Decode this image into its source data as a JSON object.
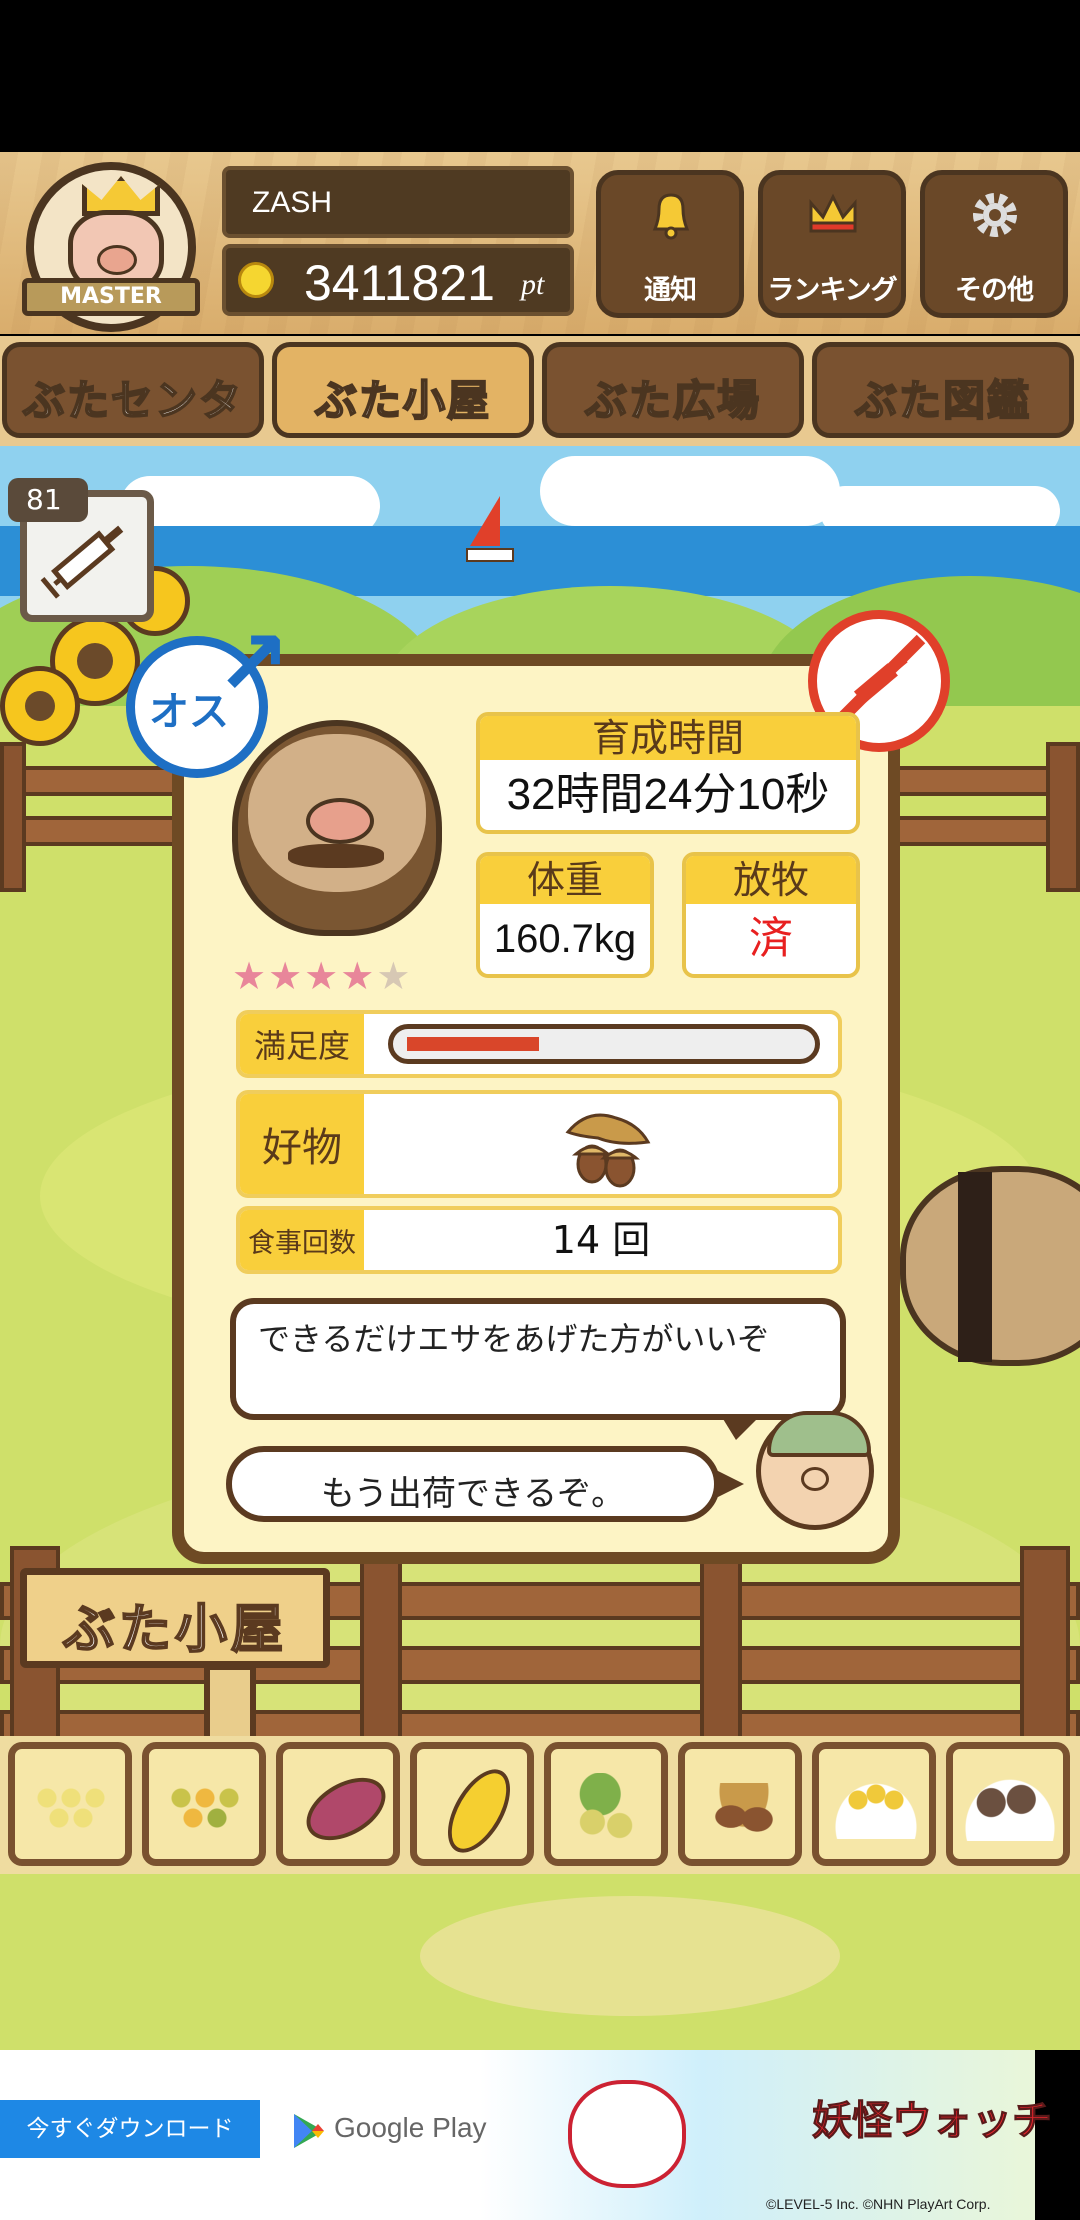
{
  "header": {
    "badge_label": "MASTER",
    "username": "ZASH",
    "points_value": "3411821",
    "points_unit": "pt",
    "buttons": [
      {
        "label": "通知",
        "icon": "bell-icon"
      },
      {
        "label": "ランキング",
        "icon": "crown-icon"
      },
      {
        "label": "その他",
        "icon": "gear-icon"
      }
    ]
  },
  "tabs": [
    {
      "label": "ぶたセンター",
      "selected": false
    },
    {
      "label": "ぶた小屋",
      "selected": true
    },
    {
      "label": "ぶた広場",
      "selected": false
    },
    {
      "label": "ぶた図鑑",
      "selected": false
    }
  ],
  "item": {
    "count": "81",
    "icon": "syringe-icon"
  },
  "pig": {
    "gender_label": "オス",
    "stars_total": 5,
    "stars_filled": 4,
    "growth_time_label": "育成時間",
    "growth_time_value": "32時間24分10秒",
    "weight_label": "体重",
    "weight_value": "160.7kg",
    "graze_label": "放牧",
    "graze_value": "済",
    "satisfaction_label": "満足度",
    "satisfaction_level": 0.33,
    "favorite_label": "好物",
    "favorite_icon": "acorn-icon",
    "meal_label": "食事回数",
    "meal_count": "14 回",
    "advice": "できるだけエサをあげた方がいいぞ",
    "status_message": "もう出荷できるぞ。"
  },
  "sign": {
    "label": "ぶた小屋"
  },
  "foods": [
    {
      "icon": "soybeans-icon"
    },
    {
      "icon": "mixed-grain-icon"
    },
    {
      "icon": "sweet-potato-icon"
    },
    {
      "icon": "corn-icon"
    },
    {
      "icon": "leafy-beans-icon"
    },
    {
      "icon": "acorn-icon"
    },
    {
      "icon": "grain-plate-icon"
    },
    {
      "icon": "dumpling-plate-icon"
    }
  ],
  "ad": {
    "button_label": "今すぐダウンロード",
    "store_label": "Google Play",
    "game_title": "妖怪ウォッチ",
    "copyright": "©LEVEL-5 Inc. ©NHN PlayArt Corp."
  },
  "colors": {
    "wood_dark": "#4b3520",
    "wood_tab": "#7a5230",
    "accent_yellow": "#f9cf3b",
    "status_red": "#e82020",
    "male_blue": "#1e6fc4",
    "bar_fill": "#d9462a"
  }
}
